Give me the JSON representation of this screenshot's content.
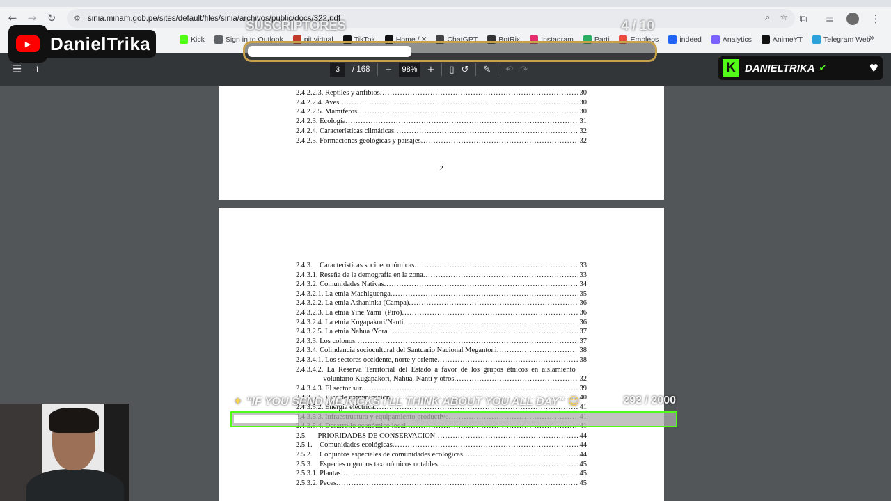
{
  "browser": {
    "url": "sinia.minam.gob.pe/sites/default/files/sinia/archivos/public/docs/322.pdf",
    "bookmarks": [
      {
        "label": "Kick",
        "color": "#53fc18"
      },
      {
        "label": "Sign in to Outlook",
        "color": "#5f6368"
      },
      {
        "label": "pit virtual",
        "color": "#c0392b"
      },
      {
        "label": "TikTok",
        "color": "#111111"
      },
      {
        "label": "Home / X",
        "color": "#111111"
      },
      {
        "label": "ChatGPT",
        "color": "#444444"
      },
      {
        "label": "BotRix",
        "color": "#333333"
      },
      {
        "label": "Instagram",
        "color": "#e1306c"
      },
      {
        "label": "Parti",
        "color": "#27ae60"
      },
      {
        "label": "Empleos",
        "color": "#e74c3c"
      },
      {
        "label": "indeed",
        "color": "#2164f3"
      },
      {
        "label": "Analytics",
        "color": "#7b61ff"
      },
      {
        "label": "AnimeYT",
        "color": "#111111"
      },
      {
        "label": "Telegram Web",
        "color": "#2aa1da"
      }
    ]
  },
  "pdf_toolbar": {
    "left_page": "1",
    "current_page": "3",
    "total_pages": "/ 168",
    "zoom": "98%"
  },
  "page1": {
    "rows": [
      {
        "title": "2.4.2.2.3. Reptiles y anfibios",
        "page": "30"
      },
      {
        "title": "2.4.2.2.4. Aves",
        "page": "30"
      },
      {
        "title": "2.4.2.2.5. Mamíferos",
        "page": "30"
      },
      {
        "title": "2.4.2.3. Ecología",
        "page": "31"
      },
      {
        "title": "2.4.2.4. Características climáticas",
        "page": "32"
      },
      {
        "title": "2.4.2.5. Formaciones geológicas y paisajes",
        "page": "32"
      }
    ],
    "page_number": "2"
  },
  "page2": {
    "rows": [
      {
        "title": "2.4.3.    Características socioeconómicas",
        "page": "33"
      },
      {
        "title": "2.4.3.1. Reseña de la demografía en la zona",
        "page": "33"
      },
      {
        "title": "2.4.3.2. Comunidades Nativas",
        "page": "34"
      },
      {
        "title": "2.4.3.2.1. La etnia Machiguenga",
        "page": "35"
      },
      {
        "title": "2.4.3.2.2. La etnia Ashaninka (Campa)",
        "page": "36"
      },
      {
        "title": "2.4.3.2.3. La etnia Yine Yami  (Piro)",
        "page": "36"
      },
      {
        "title": "2.4.3.2.4. La etnia Kugapakori/Nanti",
        "page": "36"
      },
      {
        "title": "2.4.3.2.5. La etnia Nahua /Yora",
        "page": "37"
      },
      {
        "title": "2.4.3.3. Los colonos",
        "page": "37"
      },
      {
        "title": "2.4.3.4. Colindancia sociocultural del Santuario Nacional Megantoni",
        "page": "38"
      },
      {
        "title": "2.4.3.4.1. Los sectores occidente, norte y oriente",
        "page": "38"
      },
      {
        "title": "2.4.3.4.2.  La  Reserva  Territorial  del  Estado  a  favor  de  los  grupos  étnicos  en  aislamiento",
        "page": ""
      },
      {
        "title": "               voluntario Kugapakori, Nahua, Nanti y otros",
        "page": "32"
      },
      {
        "title": "2.4.3.4.3. El sector sur",
        "page": "39"
      },
      {
        "title": "2.4.3.5.1. Vías de comunicación",
        "page": "40"
      },
      {
        "title": "2.4.3.5.2. Energía eléctrica",
        "page": "41"
      },
      {
        "title": "2.4.3.5.3. Infraestructura y equipamiento productivo",
        "page": "41"
      },
      {
        "title": "2.4.3.5.4. Desarrollo económico local",
        "page": "41"
      },
      {
        "title": "2.5.      PRIORIDADES DE CONSERVACIÓN",
        "page": "44"
      },
      {
        "title": "2.5.1.    Comunidades ecológicas",
        "page": "44"
      },
      {
        "title": "2.5.2.    Conjuntos especiales de comunidades ecológicas",
        "page": "44"
      },
      {
        "title": "2.5.3.    Especies o grupos taxonómicos notables",
        "page": "45"
      },
      {
        "title": "2.5.3.1. Plantas",
        "page": "45"
      },
      {
        "title": "2.5.3.2. Peces",
        "page": "45"
      }
    ]
  },
  "overlay": {
    "youtube_channel": "DanielTrika",
    "kick_channel": "DANIELTRIKA",
    "sub_goal": {
      "label": "SUSCRIPTORES",
      "count": "4 / 10",
      "progress": 0.4
    },
    "kick_goal": {
      "label": "\"IF YOU SEND ME KICKS I'LL THINK ABOUT YOU ALL DAY\"",
      "count": "292 / 2000",
      "progress": 0.146
    }
  }
}
